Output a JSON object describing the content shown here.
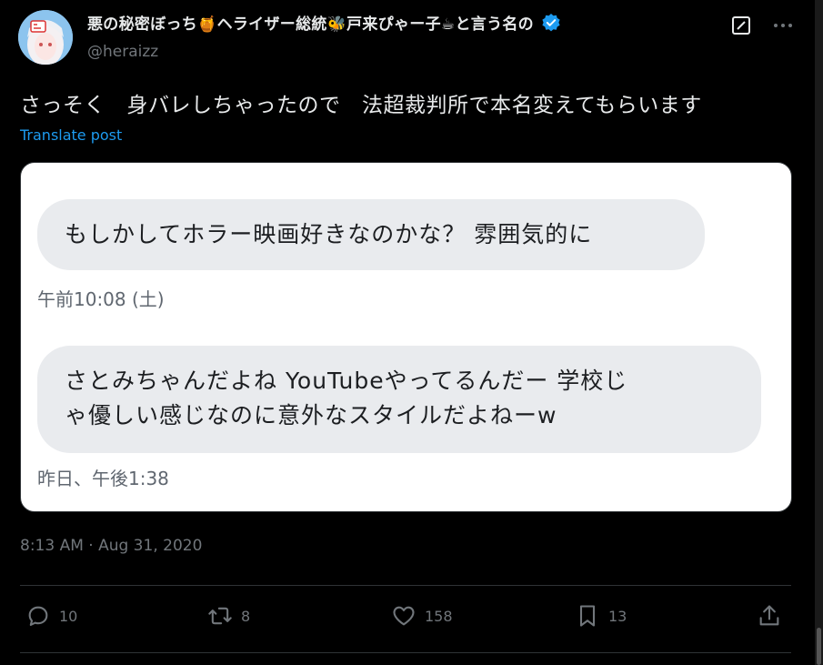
{
  "author": {
    "display_name": "悪の秘密ぼっち🍯ヘライザー総統🐝戸来ぴゃー子☕と言う名の",
    "handle": "@heraizz",
    "verified": true
  },
  "tweet": {
    "text": "さっそく　身バレしちゃったので　法超裁判所で本名変えてもらいます",
    "translate_label": "Translate post",
    "timestamp": "8:13 AM · Aug 31, 2020"
  },
  "media": {
    "messages": [
      {
        "text": "もしかしてホラー映画好きなのかな？ 雰囲気的に",
        "time": "午前10:08 (土)"
      },
      {
        "line1": "さとみちゃんだよね YouTubeやってるんだー 学校じ",
        "line2": "ゃ優しい感じなのに意外なスタイルだよねーw",
        "time": "昨日、午後1:38"
      }
    ]
  },
  "actions": {
    "replies": "10",
    "reposts": "8",
    "likes": "158",
    "bookmarks": "13"
  },
  "icons": {
    "verified": "verified-badge-icon",
    "grok": "grok-icon",
    "reply": "reply-icon",
    "repost": "repost-icon",
    "like": "heart-icon",
    "bookmark": "bookmark-icon",
    "share": "share-icon"
  },
  "colors": {
    "background": "#000000",
    "text": "#e7e9ea",
    "secondary": "#71767b",
    "accent": "#1d9bf0"
  }
}
